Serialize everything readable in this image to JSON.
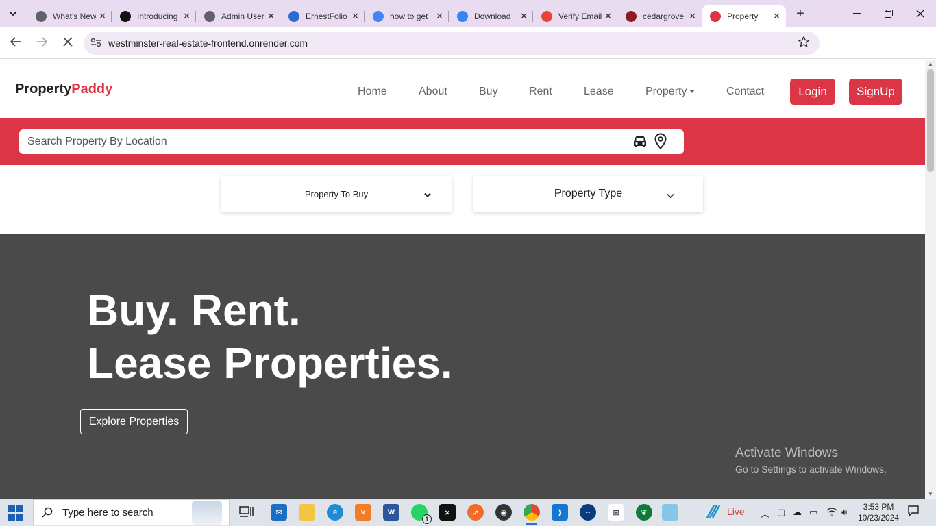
{
  "browser": {
    "tabs": [
      {
        "label": "What's New",
        "favicon": "chrome-icon",
        "color": "#5f6368"
      },
      {
        "label": "Introducing",
        "favicon": "openai-icon",
        "color": "#111111"
      },
      {
        "label": "Admin Users",
        "favicon": "openai-icon",
        "color": "#5f6368"
      },
      {
        "label": "ErnestFolio",
        "favicon": "ef-icon",
        "color": "#2b6cd3"
      },
      {
        "label": "how to get",
        "favicon": "google-icon",
        "color": "#4285f4"
      },
      {
        "label": "Download",
        "favicon": "heart-icon",
        "color": "#3b82f6"
      },
      {
        "label": "Verify Email",
        "favicon": "gmail-icon",
        "color": "#ea4335"
      },
      {
        "label": "cedargrove",
        "favicon": "cedar-icon",
        "color": "#8b1e1e"
      },
      {
        "label": "Property",
        "favicon": "property-icon",
        "color": "#dc3545"
      }
    ],
    "active_tab_index": 8,
    "url": "westminster-real-estate-frontend.onrender.com"
  },
  "site": {
    "brand_main": "Property",
    "brand_accent": "Paddy",
    "nav": [
      {
        "label": "Home"
      },
      {
        "label": "About"
      },
      {
        "label": "Buy"
      },
      {
        "label": "Rent"
      },
      {
        "label": "Lease"
      },
      {
        "label": "Property"
      },
      {
        "label": "Contact"
      }
    ],
    "login_label": "Login",
    "signup_label": "SignUp",
    "accent_color": "#dc3545",
    "search_placeholder": "Search Property By Location",
    "filters": {
      "transaction": "Property To Buy",
      "type": "Property Type"
    },
    "hero": {
      "line1": "Buy. Rent.",
      "line2": "Lease Properties.",
      "cta": "Explore Properties"
    }
  },
  "watermark": {
    "title": "Activate Windows",
    "subtitle": "Go to Settings to activate Windows."
  },
  "taskbar": {
    "search_placeholder": "Type here to search",
    "live_label": "Live",
    "time": "3:53 PM",
    "date": "10/23/2024",
    "whatsapp_badge": "1"
  }
}
